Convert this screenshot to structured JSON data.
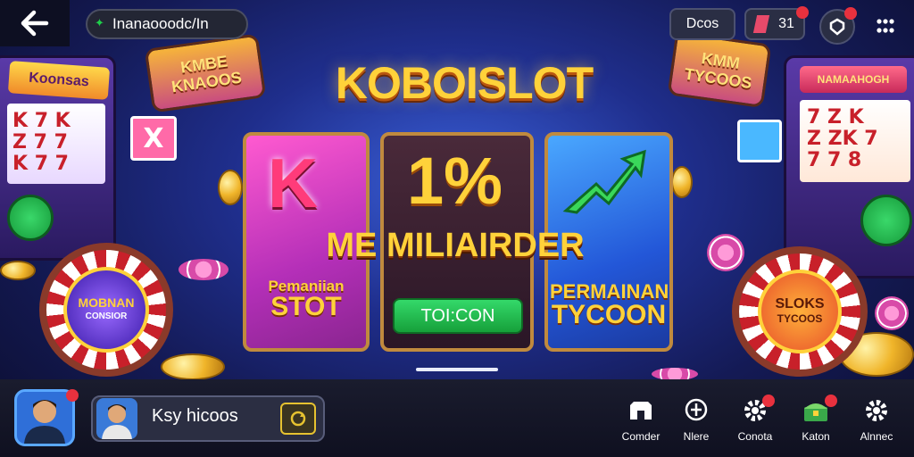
{
  "top_bar": {
    "game_name": "Inanaooodc/In",
    "chat_label": "Dcos",
    "tickets_count": "31"
  },
  "signs": {
    "left_top": "Koonsas",
    "left_banner_1": "KMBE",
    "left_banner_2": "KNAOOS",
    "right_banner_1": "KMM",
    "right_banner_2": "TYCOOS",
    "right_machine": "NAMAAHOGH"
  },
  "hero": {
    "title": "KOBOISLOT",
    "subtitle": "ME MILIAIRDER",
    "card_k_symbol": "K",
    "card_pc_symbol": "1%",
    "card_k_label_1": "Pemaniian",
    "card_k_label_2": "STOT",
    "card_pc_button": "TOI:CON",
    "card_ty_label_1": "PERMAINAN",
    "card_ty_label_2": "TYCOON"
  },
  "wheels": {
    "left_1": "MOBNAN",
    "left_2": "CONSIOR",
    "right_1": "SLOKS",
    "right_2": "TYCOOS"
  },
  "player": {
    "name": "Ksy hicoos"
  },
  "nav": [
    {
      "label": "Comder"
    },
    {
      "label": "Nlere"
    },
    {
      "label": "Conota"
    },
    {
      "label": "Katon"
    },
    {
      "label": "Alnnec"
    }
  ],
  "colors": {
    "accent_gold": "#ffd23a",
    "notification_red": "#e8313e",
    "button_green": "#22b84a"
  }
}
